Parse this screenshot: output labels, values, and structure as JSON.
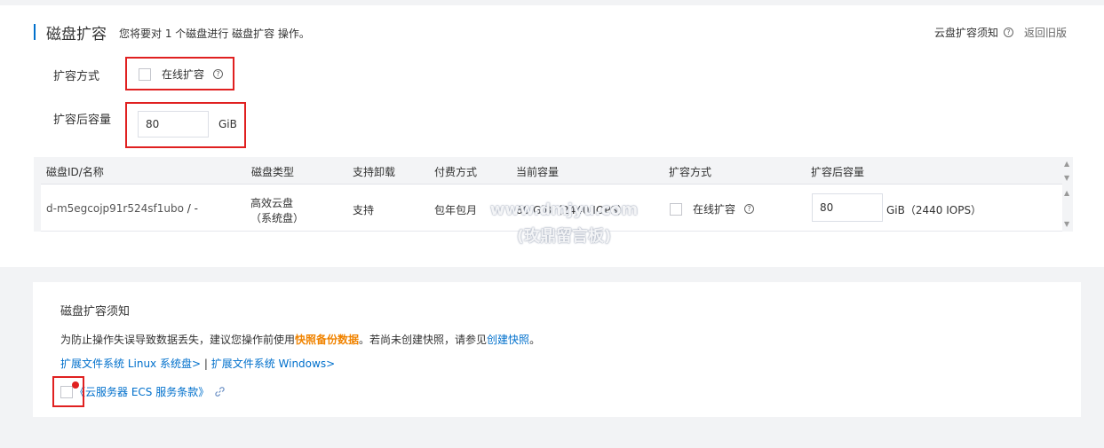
{
  "header": {
    "title": "磁盘扩容",
    "description": "您将要对 1 个磁盘进行 磁盘扩容 操作。",
    "notice_link": "云盘扩容须知",
    "back_link": "返回旧版"
  },
  "form": {
    "method_label": "扩容方式",
    "online_option": "在线扩容",
    "size_label": "扩容后容量",
    "size_value": "80",
    "size_unit": "GiB"
  },
  "table": {
    "columns": [
      "磁盘ID/名称",
      "磁盘类型",
      "支持卸载",
      "付费方式",
      "当前容量",
      "扩容方式",
      "扩容后容量"
    ],
    "row": {
      "disk_id": "d-m5egcojp91r524sf1ubo",
      "disk_name": "/ -",
      "type_line1": "高效云盘",
      "type_line2": "（系统盘）",
      "detachable": "支持",
      "billing": "包年包月",
      "current_size": "80 GiB（2440 IOPS）",
      "method": "在线扩容",
      "new_size": "80",
      "new_size_unit": "GiB（2440 IOPS）"
    }
  },
  "watermark": {
    "line1": "www.dmjyu.com",
    "line2": "(玫鼎留言板)"
  },
  "notice": {
    "title": "磁盘扩容须知",
    "text_prefix": "为防止操作失误导致数据丢失，建议您操作前使用",
    "text_highlight": "快照备份数据",
    "text_middle": "。若尚未创建快照，请参见",
    "text_link": "创建快照",
    "text_suffix": "。",
    "link_linux": "扩展文件系统 Linux 系统盘>",
    "link_separator": " | ",
    "link_windows": "扩展文件系统 Windows>",
    "terms": "《云服务器 ECS 服务条款》"
  }
}
